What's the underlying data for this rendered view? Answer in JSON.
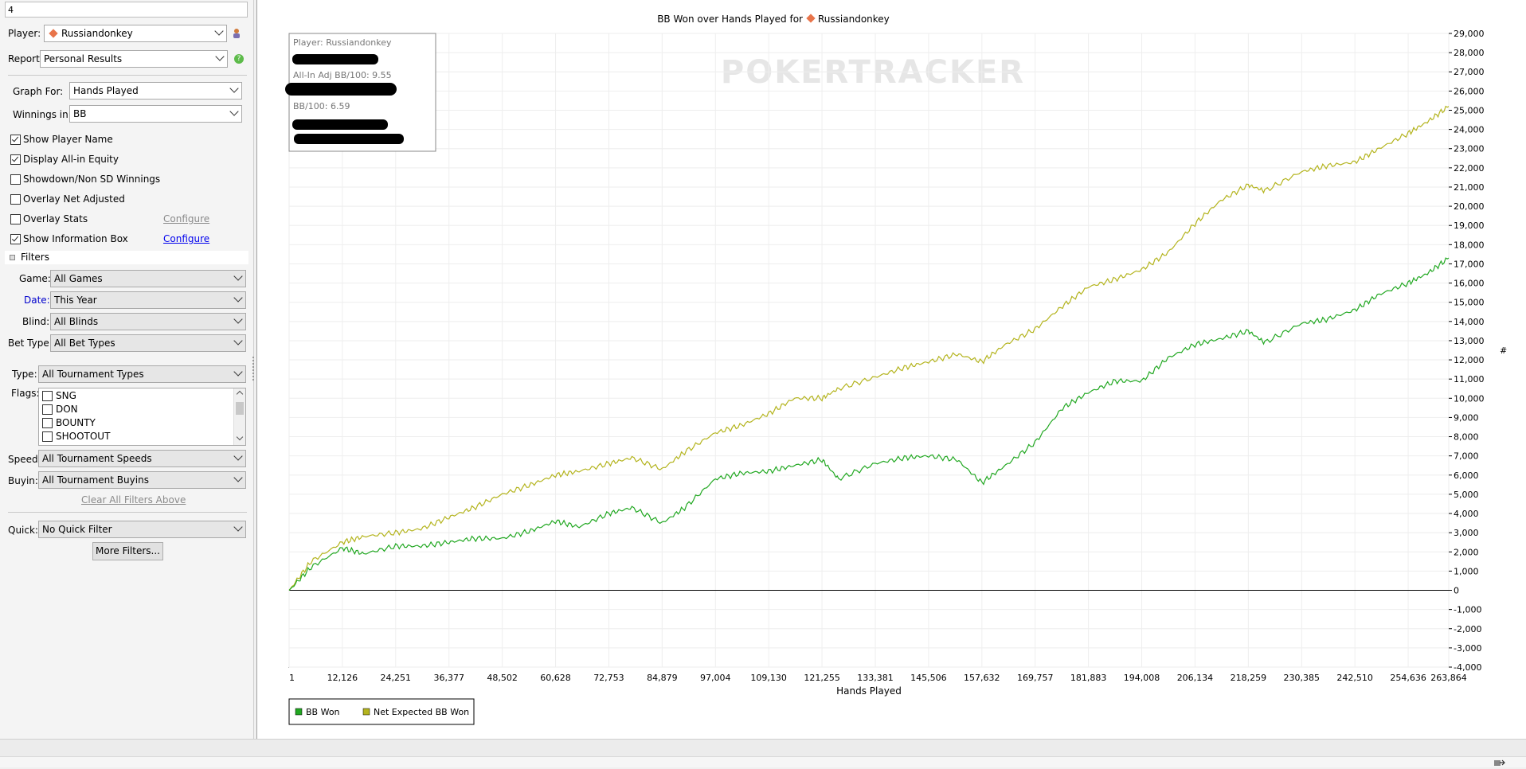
{
  "top_input": {
    "value": "4"
  },
  "player": {
    "label": "Player:",
    "value": "Russiandonkey"
  },
  "report": {
    "label": "Report:",
    "value": "Personal Results"
  },
  "graph_for": {
    "label": "Graph For:",
    "value": "Hands Played"
  },
  "winnings_in": {
    "label": "Winnings in:",
    "value": "BB"
  },
  "options": [
    {
      "label": "Show Player Name",
      "checked": true
    },
    {
      "label": "Display All-in Equity",
      "checked": true
    },
    {
      "label": "Showdown/Non SD Winnings",
      "checked": false
    },
    {
      "label": "Overlay Net Adjusted",
      "checked": false
    },
    {
      "label": "Overlay Stats",
      "checked": false
    },
    {
      "label": "Show Information Box",
      "checked": true
    }
  ],
  "configure_overlay_label": "Configure",
  "configure_info_label": "Configure",
  "filters_header": "Filters",
  "filters": {
    "game": {
      "label": "Game:",
      "value": "All Games"
    },
    "date": {
      "label": "Date:",
      "value": "This Year"
    },
    "blind": {
      "label": "Blind:",
      "value": "All Blinds"
    },
    "bet_type": {
      "label": "Bet Type:",
      "value": "All Bet Types"
    },
    "type": {
      "label": "Type:",
      "value": "All Tournament Types"
    },
    "flags_label": "Flags:",
    "flags": [
      {
        "label": "SNG",
        "checked": false
      },
      {
        "label": "DON",
        "checked": false
      },
      {
        "label": "BOUNTY",
        "checked": false
      },
      {
        "label": "SHOOTOUT",
        "checked": false
      }
    ],
    "speed": {
      "label": "Speed:",
      "value": "All Tournament Speeds"
    },
    "buyin": {
      "label": "Buyin:",
      "value": "All Tournament Buyins"
    },
    "clear_label": "Clear All Filters Above",
    "quick": {
      "label": "Quick:",
      "value": "No Quick Filter"
    },
    "more_label": "More Filters..."
  },
  "colors": {
    "link_blue": "#0000ee",
    "date_label_blue": "#0000cc",
    "bb_won": "#22a822",
    "net_expected": "#b4b41e",
    "zero_line": "#000000",
    "grid": "#eeeeee"
  },
  "info_box": {
    "player": "Player: Russiandonkey",
    "allin_adj": "All-In Adj BB/100: 9.55",
    "bb100": "BB/100: 6.59"
  },
  "watermark": "POKERTRACKER",
  "chart_data": {
    "type": "line",
    "title": "BB Won over Hands Played for Russiandonkey",
    "title_prefix": "BB Won over Hands Played for",
    "title_player": "Russiandonkey",
    "xlabel": "Hands Played",
    "ylabel": "",
    "x_ticks": [
      "1",
      "12,126",
      "24,251",
      "36,377",
      "48,502",
      "60,628",
      "72,753",
      "84,879",
      "97,004",
      "109,130",
      "121,255",
      "133,381",
      "145,506",
      "157,632",
      "169,757",
      "181,883",
      "194,008",
      "206,134",
      "218,259",
      "230,385",
      "242,510",
      "254,636",
      "263,864"
    ],
    "y_ticks": [
      "29,000",
      "28,000",
      "27,000",
      "26,000",
      "25,000",
      "24,000",
      "23,000",
      "22,000",
      "21,000",
      "20,000",
      "19,000",
      "18,000",
      "17,000",
      "16,000",
      "15,000",
      "14,000",
      "13,000",
      "12,000",
      "11,000",
      "10,000",
      "9,000",
      "8,000",
      "7,000",
      "6,000",
      "5,000",
      "4,000",
      "3,000",
      "2,000",
      "1,000",
      "0",
      "-1,000",
      "-2,000",
      "-3,000",
      "-4,000"
    ],
    "xlim": [
      1,
      263864
    ],
    "ylim": [
      -4000,
      29000
    ],
    "grid": true,
    "legend_position": "bottom-left",
    "series": [
      {
        "name": "BB Won",
        "x": [
          1,
          5000,
          12126,
          17000,
          24251,
          30000,
          36377,
          42000,
          48502,
          55000,
          60628,
          66000,
          72753,
          78000,
          84879,
          90000,
          97004,
          103000,
          109130,
          115000,
          121255,
          125000,
          133381,
          140000,
          145506,
          152000,
          157632,
          163000,
          169757,
          176000,
          181883,
          188000,
          194008,
          200000,
          206134,
          212000,
          218259,
          222000,
          230385,
          236000,
          242510,
          248000,
          254636,
          259000,
          263864
        ],
        "y": [
          0,
          1200,
          2200,
          1900,
          2300,
          2300,
          2500,
          2700,
          2700,
          3100,
          3600,
          3300,
          4000,
          4300,
          3500,
          4300,
          5800,
          6100,
          6200,
          6500,
          6800,
          5800,
          6600,
          6900,
          7000,
          6800,
          5600,
          6500,
          7700,
          9500,
          10300,
          10900,
          10900,
          12100,
          12800,
          13100,
          13500,
          12900,
          13900,
          14100,
          14600,
          15400,
          16000,
          16500,
          17300
        ]
      },
      {
        "name": "Net Expected BB Won",
        "x": [
          1,
          5000,
          12126,
          17000,
          24251,
          30000,
          36377,
          42000,
          48502,
          55000,
          60628,
          66000,
          72753,
          78000,
          84879,
          90000,
          97004,
          103000,
          109130,
          115000,
          121255,
          125000,
          133381,
          140000,
          145506,
          152000,
          157632,
          163000,
          169757,
          176000,
          181883,
          188000,
          194008,
          200000,
          206134,
          212000,
          218259,
          222000,
          230385,
          236000,
          242510,
          248000,
          254636,
          259000,
          263864
        ],
        "y": [
          0,
          1500,
          2500,
          2800,
          3000,
          3200,
          3800,
          4300,
          5000,
          5500,
          6000,
          6200,
          6600,
          6900,
          6300,
          7200,
          8200,
          8600,
          9200,
          10000,
          10000,
          10500,
          11100,
          11600,
          11900,
          12300,
          11900,
          12800,
          13600,
          14800,
          15800,
          16200,
          16700,
          17600,
          19100,
          20300,
          21100,
          20800,
          21800,
          22100,
          22300,
          23000,
          23800,
          24400,
          25200
        ]
      }
    ]
  }
}
